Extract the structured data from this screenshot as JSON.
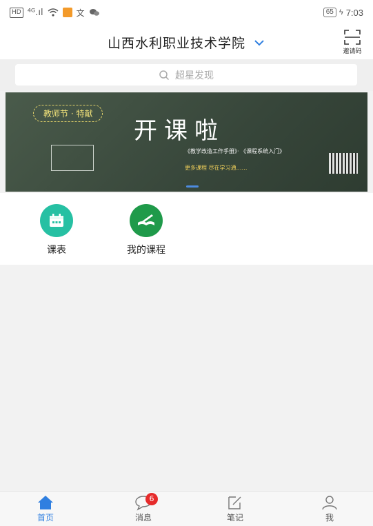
{
  "status_bar": {
    "left_text": "HD",
    "signal": "⁴ᴳ.ıl",
    "battery": "65",
    "time": "7:03"
  },
  "header": {
    "school_name": "山西水利职业技术学院",
    "invite_label": "邀请码"
  },
  "search": {
    "placeholder": "超星发现"
  },
  "banner": {
    "tag": "教师节 · 特献",
    "headline": "开课啦",
    "line1": "《教学改造工作手册》· 《课程系统入门》",
    "line2": "更多课程 尽在学习通……"
  },
  "shortcuts": [
    {
      "label": "课表",
      "icon": "calendar-icon",
      "color": "#26c0a3"
    },
    {
      "label": "我的课程",
      "icon": "book-pen-icon",
      "color": "#1f9a4a"
    }
  ],
  "tabs": [
    {
      "label": "首页",
      "icon": "home-icon",
      "active": true
    },
    {
      "label": "消息",
      "icon": "chat-bubble-icon",
      "badge": "6"
    },
    {
      "label": "笔记",
      "icon": "note-edit-icon"
    },
    {
      "label": "我",
      "icon": "person-icon"
    }
  ],
  "colors": {
    "accent": "#2f7fe0",
    "badge": "#e62b2b"
  }
}
